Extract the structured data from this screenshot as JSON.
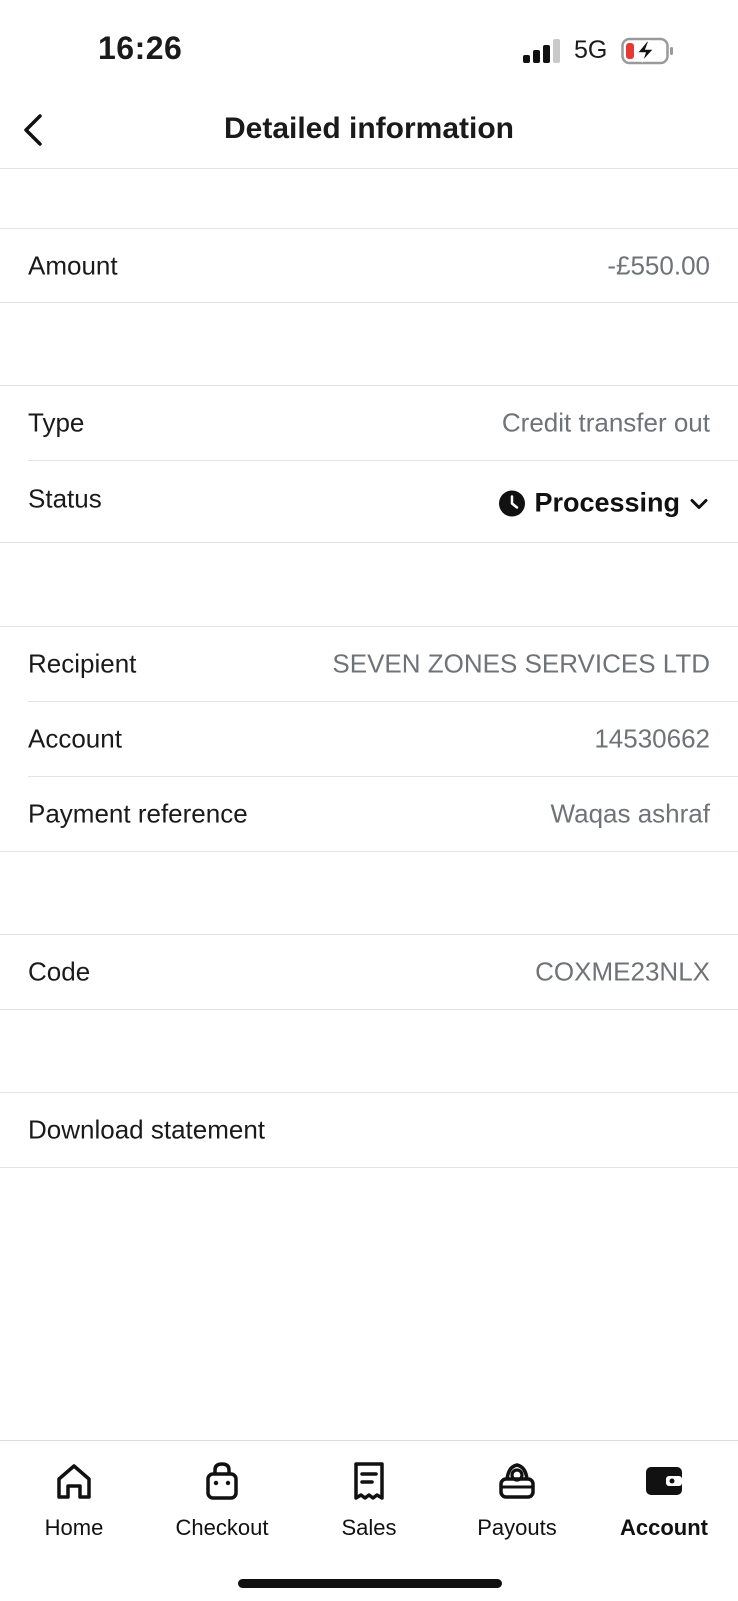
{
  "status_bar": {
    "time": "16:26",
    "network": "5G"
  },
  "header": {
    "title": "Detailed information"
  },
  "details": {
    "amount": {
      "label": "Amount",
      "value": "-£550.00"
    },
    "type": {
      "label": "Type",
      "value": "Credit transfer out"
    },
    "status": {
      "label": "Status",
      "value": "Processing"
    },
    "recipient": {
      "label": "Recipient",
      "value": "SEVEN ZONES SERVICES LTD"
    },
    "account": {
      "label": "Account",
      "value": "14530662"
    },
    "payment_reference": {
      "label": "Payment reference",
      "value": "Waqas ashraf"
    },
    "code": {
      "label": "Code",
      "value": "COXME23NLX"
    },
    "download": {
      "label": "Download statement"
    }
  },
  "tabs": [
    {
      "label": "Home",
      "icon": "home-icon"
    },
    {
      "label": "Checkout",
      "icon": "bag-icon"
    },
    {
      "label": "Sales",
      "icon": "receipt-icon"
    },
    {
      "label": "Payouts",
      "icon": "payouts-icon"
    },
    {
      "label": "Account",
      "icon": "wallet-icon",
      "active": true
    }
  ],
  "colors": {
    "text": "#1a1a1a",
    "muted": "#6f7378",
    "divider": "#e3e3e3",
    "battery_low": "#e53935"
  }
}
